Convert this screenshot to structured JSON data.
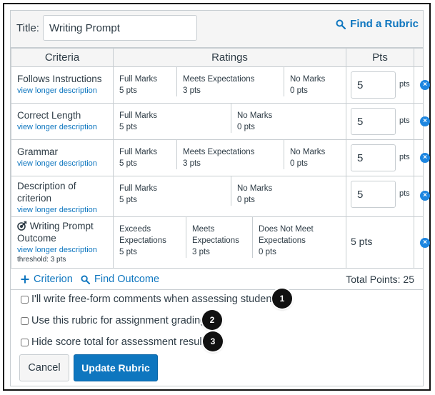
{
  "title_label": "Title:",
  "title_value": "Writing Prompt",
  "find_rubric": "Find a Rubric",
  "headers": {
    "criteria": "Criteria",
    "ratings": "Ratings",
    "pts": "Pts"
  },
  "criteria": [
    {
      "name": "Follows Instructions",
      "link": "view longer description",
      "ratings": [
        {
          "label": "Full Marks",
          "pts": "5 pts"
        },
        {
          "label": "Meets Expectations",
          "pts": "3 pts"
        },
        {
          "label": "No Marks",
          "pts": "0 pts"
        }
      ],
      "points": "5",
      "unit": "pts"
    },
    {
      "name": "Correct Length",
      "link": "view longer description",
      "ratings": [
        {
          "label": "Full Marks",
          "pts": "5 pts"
        },
        {
          "label": "No Marks",
          "pts": "0 pts"
        }
      ],
      "points": "5",
      "unit": "pts"
    },
    {
      "name": "Grammar",
      "link": "view longer description",
      "ratings": [
        {
          "label": "Full Marks",
          "pts": "5 pts"
        },
        {
          "label": "Meets Expectations",
          "pts": "3 pts"
        },
        {
          "label": "No Marks",
          "pts": "0 pts"
        }
      ],
      "points": "5",
      "unit": "pts"
    },
    {
      "name": "Description of criterion",
      "link": "view longer description",
      "ratings": [
        {
          "label": "Full Marks",
          "pts": "5 pts"
        },
        {
          "label": "No Marks",
          "pts": "0 pts"
        }
      ],
      "points": "5",
      "unit": "pts"
    },
    {
      "name": "Writing Prompt Outcome",
      "link": "view longer description",
      "threshold": "threshold: 3 pts",
      "ratings": [
        {
          "label": "Exceeds Expectations",
          "pts": "5 pts"
        },
        {
          "label": "Meets Expectations",
          "pts": "3 pts"
        },
        {
          "label": "Does Not Meet Expectations",
          "pts": "0 pts"
        }
      ],
      "points_static": "5 pts"
    }
  ],
  "add_criterion": "Criterion",
  "find_outcome": "Find Outcome",
  "total_points": "Total Points: 25",
  "options": [
    {
      "label": "I'll write free-form comments when assessing students",
      "badge": "1"
    },
    {
      "label": "Use this rubric for assignment grading",
      "badge": "2"
    },
    {
      "label": "Hide score total for assessment results",
      "badge": "3"
    }
  ],
  "buttons": {
    "cancel": "Cancel",
    "update": "Update Rubric"
  },
  "colors": {
    "accent": "#0e76bf",
    "delete": "#1d86e0",
    "header_bg": "#f5f5f5"
  }
}
